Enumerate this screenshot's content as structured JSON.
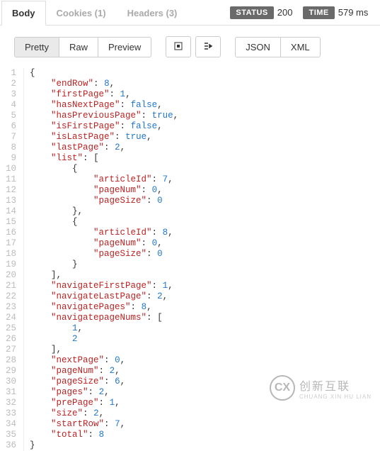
{
  "topTabs": {
    "body": "Body",
    "cookies": "Cookies (1)",
    "headers": "Headers (3)"
  },
  "status": {
    "statusLabel": "STATUS",
    "statusValue": "200",
    "timeLabel": "TIME",
    "timeValue": "579 ms"
  },
  "toolbar": {
    "pretty": "Pretty",
    "raw": "Raw",
    "preview": "Preview",
    "json": "JSON",
    "xml": "XML"
  },
  "code": {
    "lines": [
      "{",
      "    \"endRow\": 8,",
      "    \"firstPage\": 1,",
      "    \"hasNextPage\": false,",
      "    \"hasPreviousPage\": true,",
      "    \"isFirstPage\": false,",
      "    \"isLastPage\": true,",
      "    \"lastPage\": 2,",
      "    \"list\": [",
      "        {",
      "            \"articleId\": 7,",
      "            \"pageNum\": 0,",
      "            \"pageSize\": 0",
      "        },",
      "        {",
      "            \"articleId\": 8,",
      "            \"pageNum\": 0,",
      "            \"pageSize\": 0",
      "        }",
      "    ],",
      "    \"navigateFirstPage\": 1,",
      "    \"navigateLastPage\": 2,",
      "    \"navigatePages\": 8,",
      "    \"navigatepageNums\": [",
      "        1,",
      "        2",
      "    ],",
      "    \"nextPage\": 0,",
      "    \"pageNum\": 2,",
      "    \"pageSize\": 6,",
      "    \"pages\": 2,",
      "    \"prePage\": 1,",
      "    \"size\": 2,",
      "    \"startRow\": 7,",
      "    \"total\": 8",
      "}"
    ]
  },
  "watermark": {
    "main": "创新互联",
    "sub": "CHUANG XIN HU LIAN"
  },
  "chart_data": {
    "type": "table",
    "title": "Response JSON body",
    "data": {
      "endRow": 8,
      "firstPage": 1,
      "hasNextPage": false,
      "hasPreviousPage": true,
      "isFirstPage": false,
      "isLastPage": true,
      "lastPage": 2,
      "list": [
        {
          "articleId": 7,
          "pageNum": 0,
          "pageSize": 0
        },
        {
          "articleId": 8,
          "pageNum": 0,
          "pageSize": 0
        }
      ],
      "navigateFirstPage": 1,
      "navigateLastPage": 2,
      "navigatePages": 8,
      "navigatepageNums": [
        1,
        2
      ],
      "nextPage": 0,
      "pageNum": 2,
      "pageSize": 6,
      "pages": 2,
      "prePage": 1,
      "size": 2,
      "startRow": 7,
      "total": 8
    }
  }
}
